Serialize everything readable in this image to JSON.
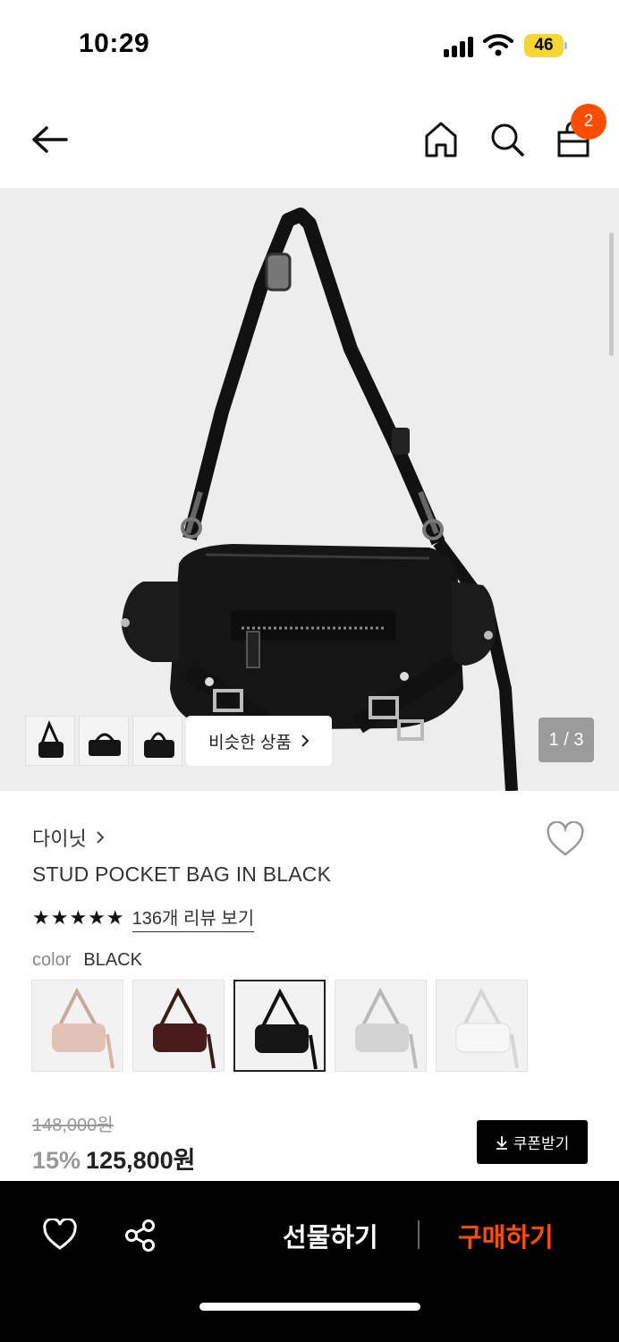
{
  "status_bar": {
    "time": "10:29",
    "battery": "46"
  },
  "nav": {
    "cart_count": "2"
  },
  "gallery": {
    "similar_label": "비슷한 상품",
    "page_indicator": "1 / 3"
  },
  "product": {
    "brand": "다이닛",
    "title": "STUD POCKET BAG IN BLACK",
    "rating_stars": "★★★★★",
    "review_link": "136개 리뷰 보기",
    "color_label": "color",
    "color_value": "BLACK",
    "swatches": [
      "beige",
      "burgundy",
      "black",
      "silver",
      "white"
    ],
    "original_price": "148,000원",
    "discount": "15%",
    "sale_price": "125,800원",
    "coupon_label": "쿠폰받기"
  },
  "bottom_bar": {
    "gift_label": "선물하기",
    "buy_label": "구매하기"
  },
  "colors": {
    "accent": "#ff4d00",
    "badge": "#ff4d00",
    "battery": "#f6d632"
  }
}
